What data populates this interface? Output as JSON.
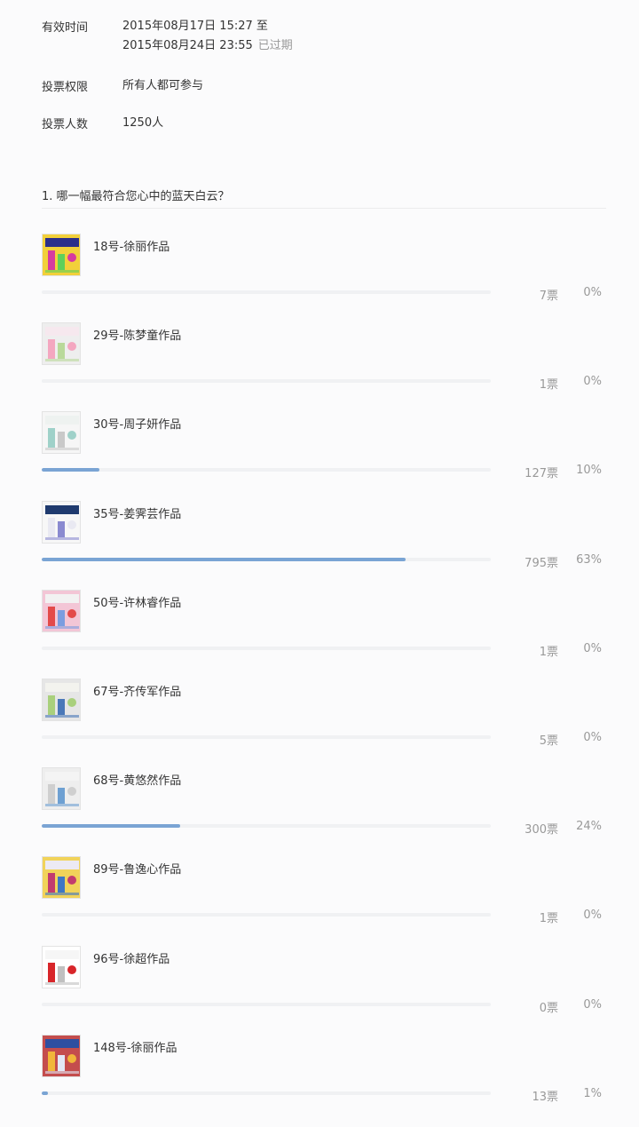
{
  "info": {
    "valid_time_label": "有效时间",
    "valid_time_start": "2015年08月17日 15:27 至",
    "valid_time_end": "2015年08月24日 23:55",
    "expired_tag": "已过期",
    "permission_label": "投票权限",
    "permission_value": "所有人都可参与",
    "voters_label": "投票人数",
    "voters_value": "1250人"
  },
  "question": "1. 哪一幅最符合您心中的蓝天白云？",
  "options": [
    {
      "label": "18号-徐丽作品",
      "votes": "7票",
      "percent": "0%",
      "fraction": 0.0
    },
    {
      "label": "29号-陈梦童作品",
      "votes": "1票",
      "percent": "0%",
      "fraction": 0.0
    },
    {
      "label": "30号-周子妍作品",
      "votes": "127票",
      "percent": "10%",
      "fraction": 0.1
    },
    {
      "label": "35号-姜霁芸作品",
      "votes": "795票",
      "percent": "63%",
      "fraction": 0.63
    },
    {
      "label": "50号-许林睿作品",
      "votes": "1票",
      "percent": "0%",
      "fraction": 0.0
    },
    {
      "label": "67号-齐传军作品",
      "votes": "5票",
      "percent": "0%",
      "fraction": 0.0
    },
    {
      "label": "68号-黄悠然作品",
      "votes": "300票",
      "percent": "24%",
      "fraction": 0.24
    },
    {
      "label": "89号-鲁逸心作品",
      "votes": "1票",
      "percent": "0%",
      "fraction": 0.0
    },
    {
      "label": "96号-徐超作品",
      "votes": "0票",
      "percent": "0%",
      "fraction": 0.0
    },
    {
      "label": "148号-徐丽作品",
      "votes": "13票",
      "percent": "1%",
      "fraction": 0.01
    }
  ],
  "colors": {
    "bar_fill": "#7aa4d4",
    "bar_track": "#f0f1f3",
    "muted_text": "#999999"
  }
}
